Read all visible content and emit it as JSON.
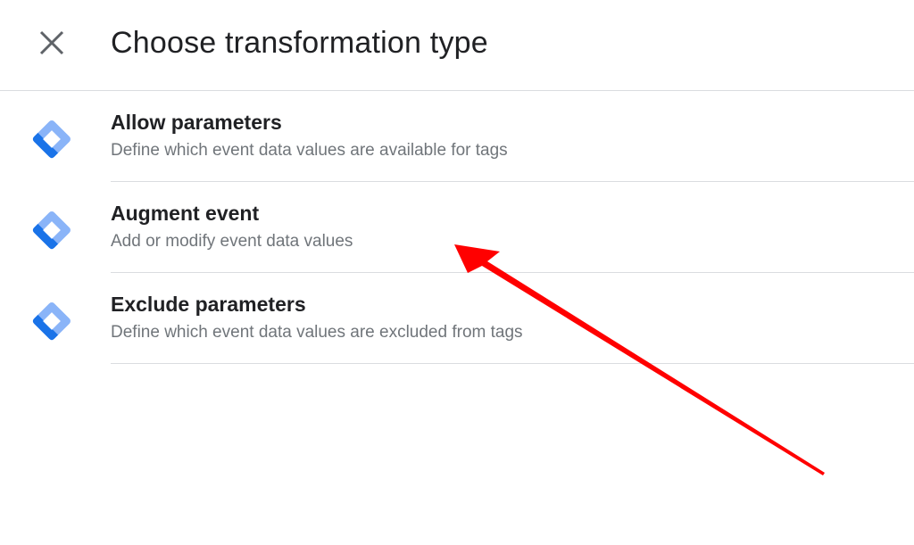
{
  "dialog": {
    "title": "Choose transformation type"
  },
  "options": [
    {
      "title": "Allow parameters",
      "description": "Define which event data values are available for tags",
      "icon": "gtm-diamond-icon"
    },
    {
      "title": "Augment event",
      "description": "Add or modify event data values",
      "icon": "gtm-diamond-icon"
    },
    {
      "title": "Exclude parameters",
      "description": "Define which event data values are excluded from tags",
      "icon": "gtm-diamond-icon"
    }
  ],
  "colors": {
    "icon_dark": "#1a73e8",
    "icon_light": "#8ab4f8",
    "annotation_arrow": "#ff0000"
  }
}
